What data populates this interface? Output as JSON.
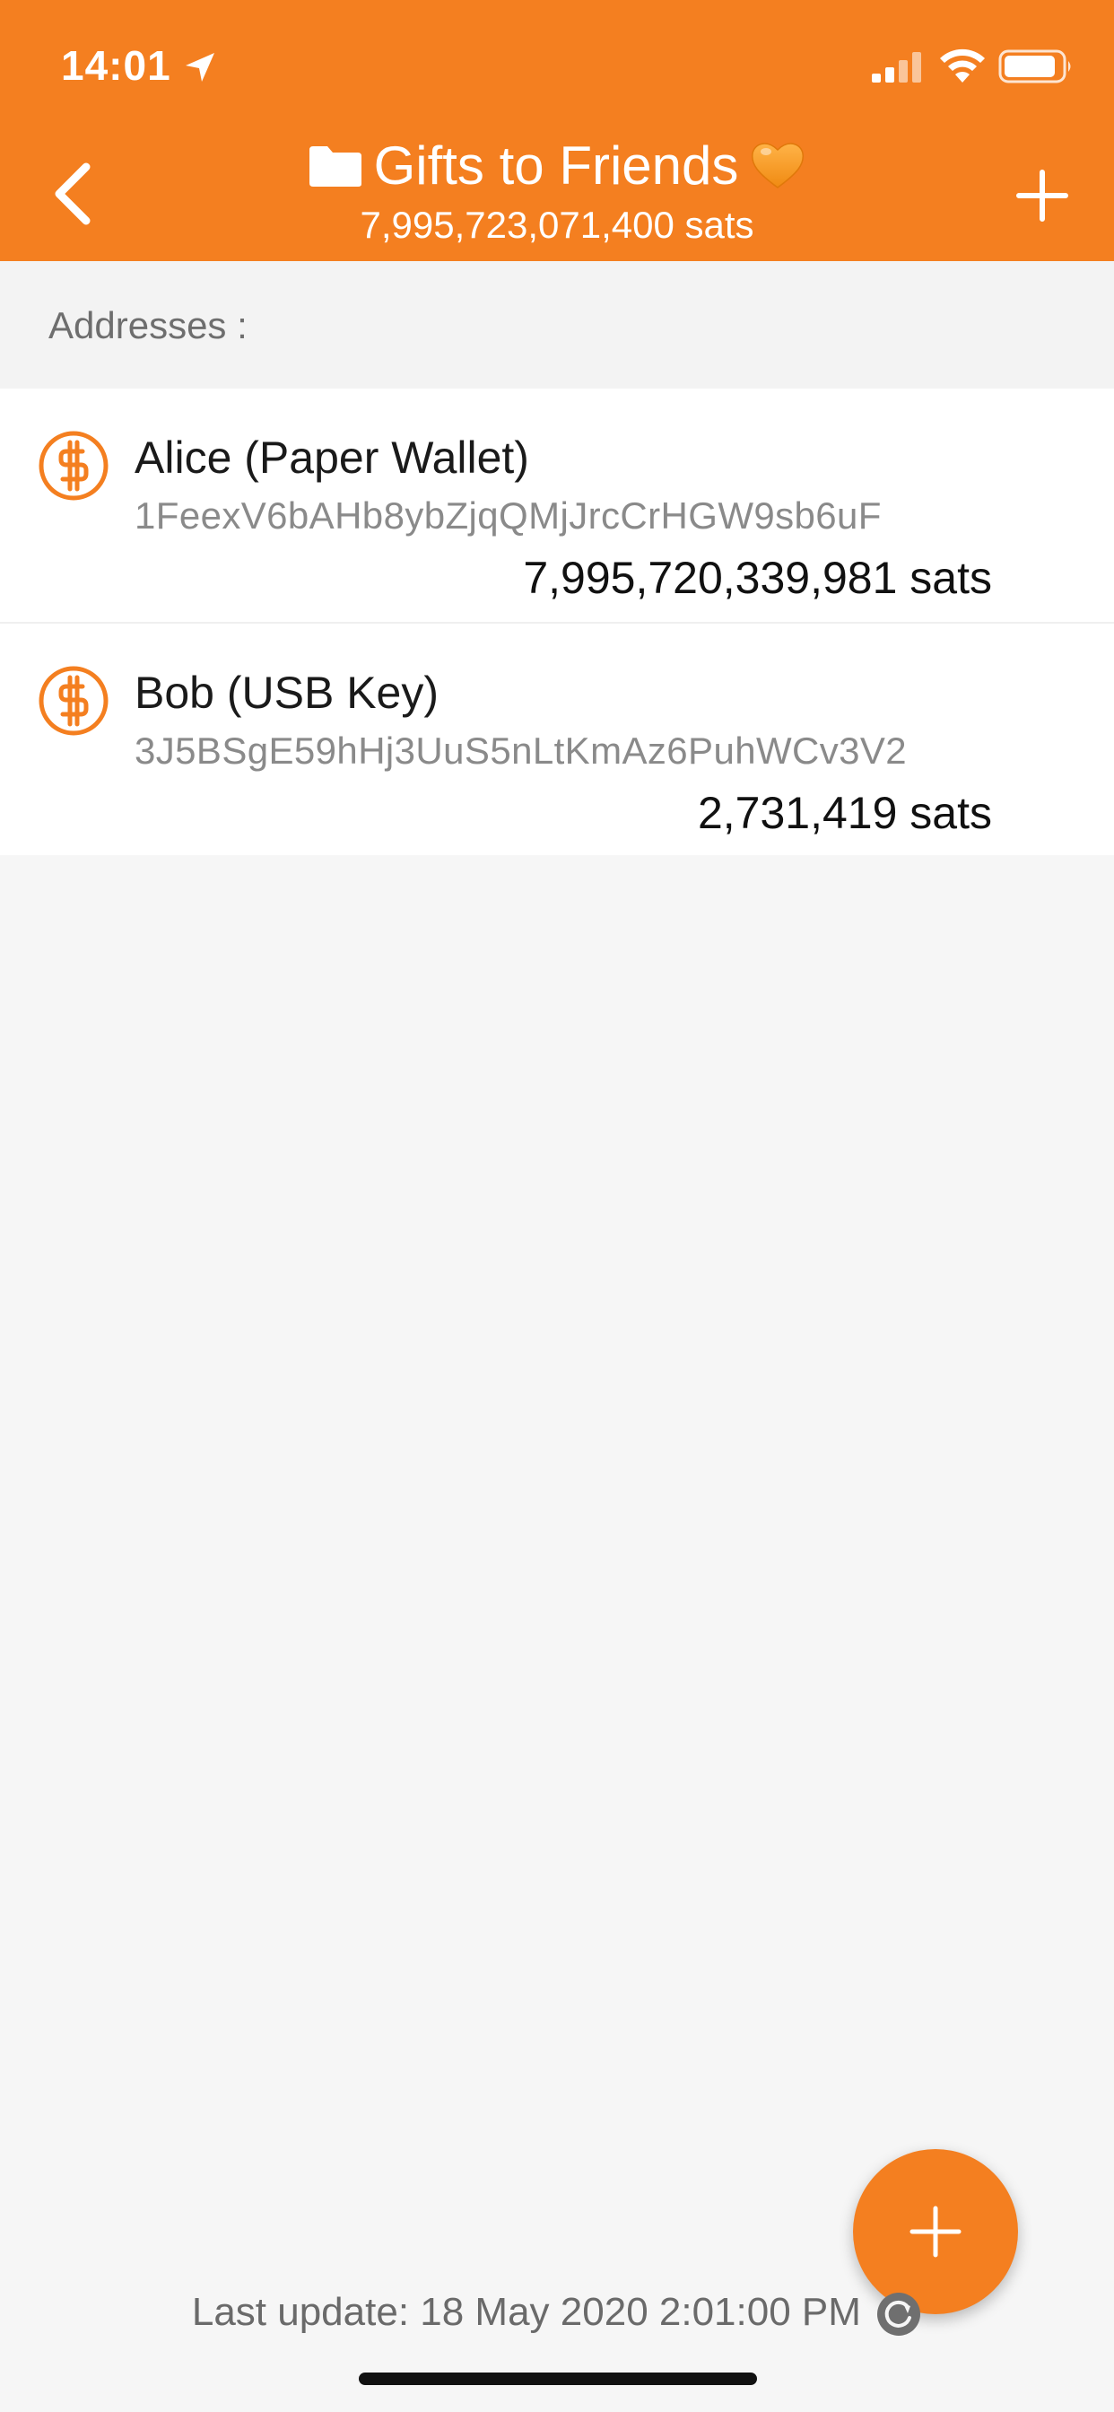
{
  "status_bar": {
    "time": "14:01"
  },
  "header": {
    "title": "Gifts to Friends",
    "subtitle": "7,995,723,071,400 sats",
    "background_color": "#f47f20"
  },
  "section": {
    "label": "Addresses :"
  },
  "addresses": [
    {
      "name": "Alice (Paper Wallet)",
      "address": "1FeexV6bAHb8ybZjqQMjJrcCrHGW9sb6uF",
      "amount": "7,995,720,339,981 sats",
      "icon": "bitcoin-coin-icon"
    },
    {
      "name": "Bob (USB Key)",
      "address": "3J5BSgE59hHj3UuS5nLtKmAz6PuhWCv3V2",
      "amount": "2,731,419 sats",
      "icon": "bitcoin-coin-icon"
    }
  ],
  "footer": {
    "last_update": "Last update: 18 May 2020 2:01:00 PM"
  }
}
